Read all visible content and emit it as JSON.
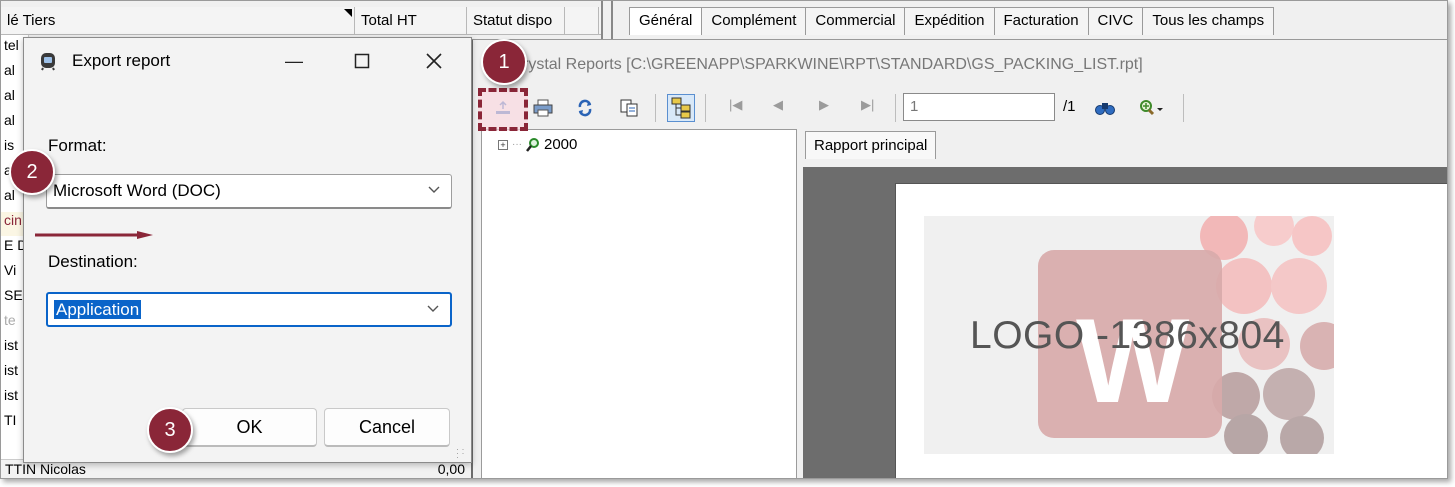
{
  "grid": {
    "columns": [
      {
        "label": "lé Tiers"
      },
      {
        "label": "Total HT"
      },
      {
        "label": "Statut dispo"
      },
      {
        "label": ""
      }
    ],
    "left_rows": [
      "tel",
      "al",
      "al",
      "al",
      "is",
      "al",
      "al",
      "cin",
      "E D",
      "Vi",
      "SEN",
      "te",
      "ist",
      "ist",
      "ist",
      "TI"
    ],
    "bottom_row": {
      "name": "TTIN Nicolas",
      "value": "0,00"
    }
  },
  "tabs": [
    "Général",
    "Complément",
    "Commercial",
    "Expédition",
    "Facturation",
    "CIVC",
    "Tous les champs"
  ],
  "crystal": {
    "title": "rystal Reports [C:\\GREENAPP\\SPARKWINE\\RPT\\STANDARD\\GS_PACKING_LIST.rpt]",
    "page_value": "1",
    "page_total": "/1",
    "tree_node": "2000",
    "report_tab": "Rapport principal",
    "logo_text": "LOGO -1386x804",
    "logo_letter": "W"
  },
  "dialog": {
    "title": "Export report",
    "format_label": "Format:",
    "format_value": "Microsoft Word (DOC)",
    "destination_label": "Destination:",
    "destination_value": "Application",
    "ok_label": "OK",
    "cancel_label": "Cancel"
  },
  "annotations": {
    "step1": "1",
    "step2": "2",
    "step3": "3",
    "color": "#8a2638"
  }
}
